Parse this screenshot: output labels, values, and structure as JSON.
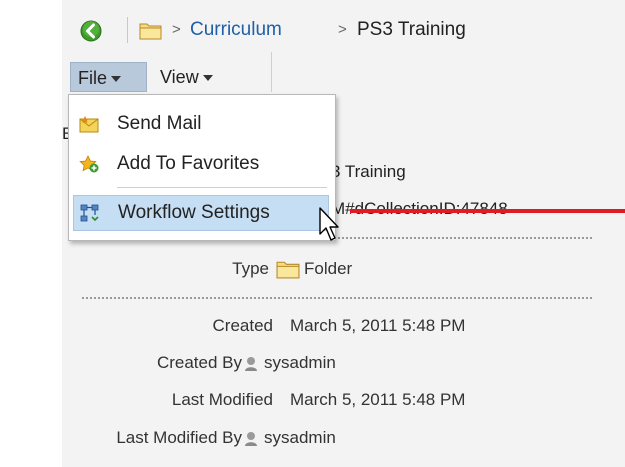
{
  "breadcrumb": {
    "items": [
      ">",
      "Curriculum",
      ">",
      "PS3 Training"
    ]
  },
  "menubar": {
    "file_label": "File",
    "view_label": "View"
  },
  "dropdown": {
    "items": [
      {
        "label": "Send Mail",
        "icon": "envelope-star-icon"
      },
      {
        "label": "Add To Favorites",
        "icon": "star-plus-icon"
      },
      {
        "label": "Workflow Settings",
        "icon": "workflow-icon",
        "highlighted": true
      }
    ]
  },
  "details": {
    "title_fragment": "3 Training",
    "url_fragment": "M#dCollectionID:47848",
    "hidden_left_letter": "E",
    "type_label": "Type",
    "type_value": "Folder",
    "created_label": "Created",
    "created_value": "March 5, 2011 5:48 PM",
    "created_by_label": "Created By",
    "created_by_value": "sysadmin",
    "modified_label": "Last Modified",
    "modified_value": "March 5, 2011 5:48 PM",
    "modified_by_label": "Last Modified By",
    "modified_by_value": "sysadmin"
  },
  "colors": {
    "accent_link": "#1f5fa8",
    "annotation_red": "#e11b22",
    "highlight": "#c6def3"
  }
}
